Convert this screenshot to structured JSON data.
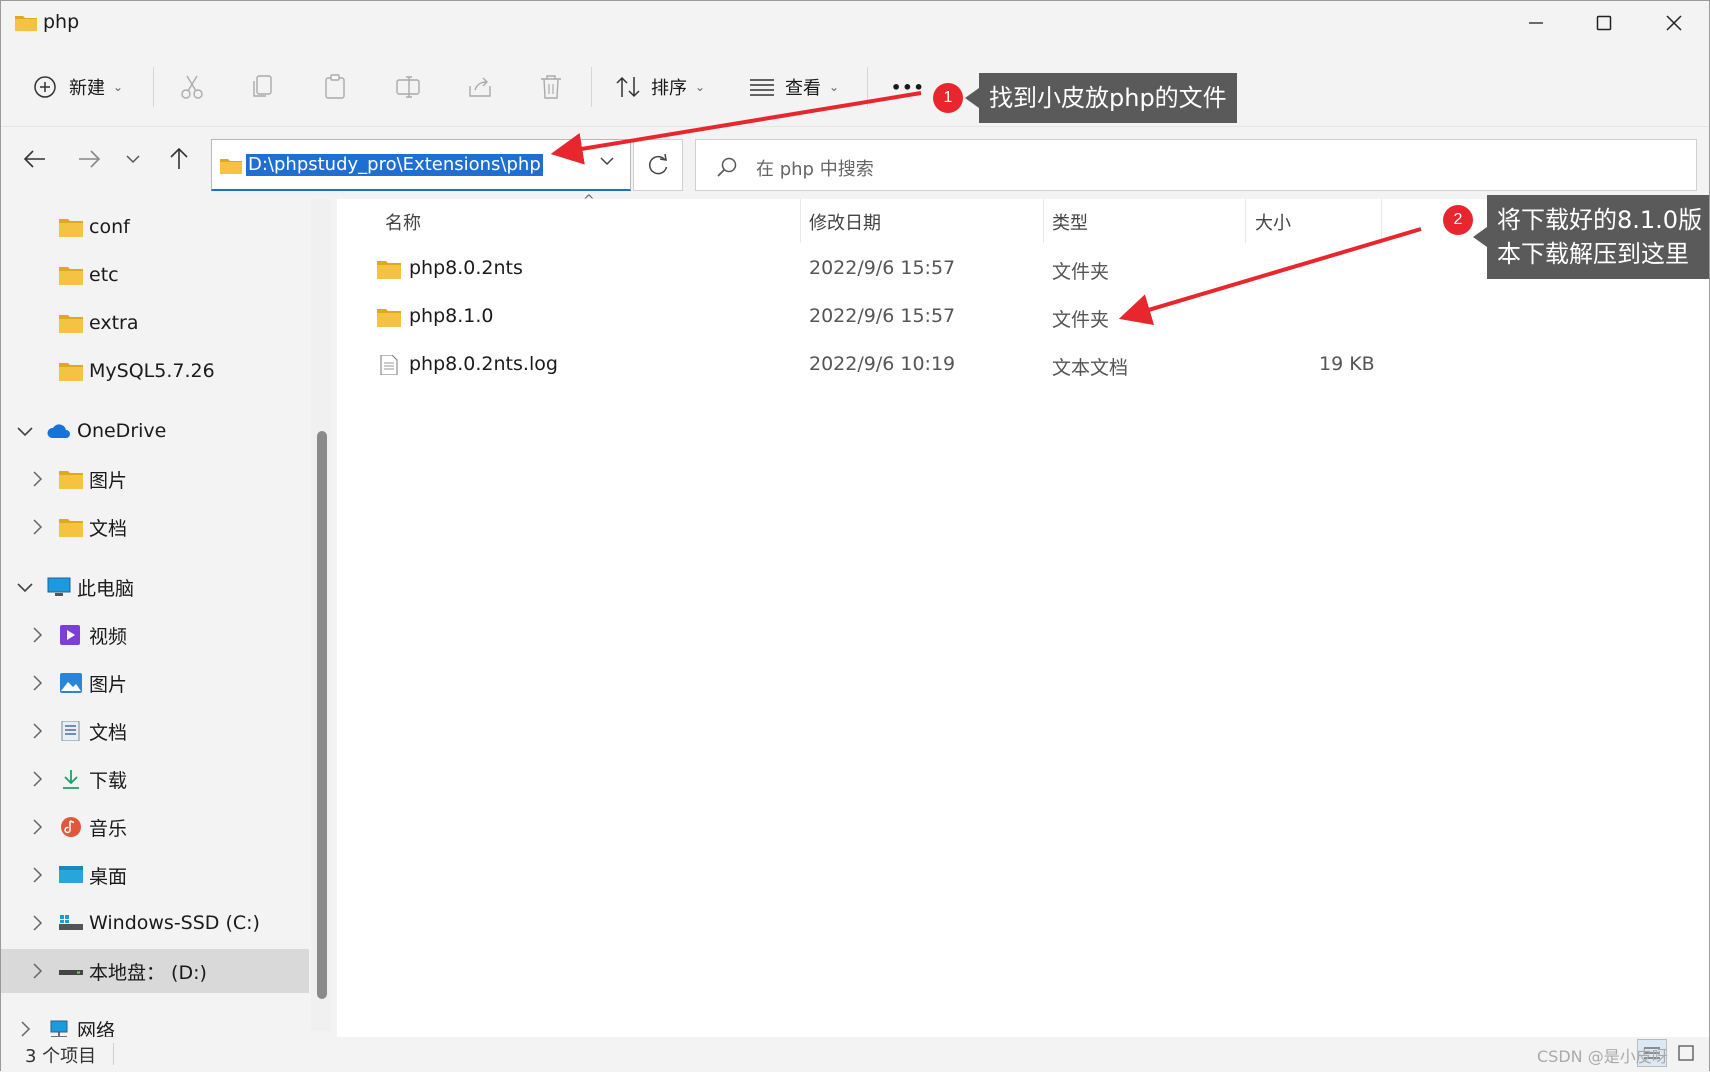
{
  "window": {
    "title": "php",
    "controls": {
      "minimize": "—",
      "maximize": "☐",
      "close": "✕"
    }
  },
  "toolbar": {
    "new_label": "新建",
    "sort_label": "排序",
    "view_label": "查看",
    "more_label": "•••"
  },
  "nav": {
    "address": "D:\\phpstudy_pro\\Extensions\\php",
    "search_placeholder": "在 php 中搜索"
  },
  "sidebar": {
    "items": [
      {
        "label": "conf",
        "icon": "folder-icon"
      },
      {
        "label": "etc",
        "icon": "folder-icon"
      },
      {
        "label": "extra",
        "icon": "folder-icon"
      },
      {
        "label": "MySQL5.7.26",
        "icon": "folder-icon"
      },
      {
        "label": "OneDrive",
        "icon": "cloud-icon"
      },
      {
        "label": "图片",
        "icon": "folder-icon"
      },
      {
        "label": "文档",
        "icon": "folder-icon"
      },
      {
        "label": "此电脑",
        "icon": "computer-icon"
      },
      {
        "label": "视频",
        "icon": "video-icon"
      },
      {
        "label": "图片",
        "icon": "pictures-icon"
      },
      {
        "label": "文档",
        "icon": "documents-icon"
      },
      {
        "label": "下载",
        "icon": "download-icon"
      },
      {
        "label": "音乐",
        "icon": "music-icon"
      },
      {
        "label": "桌面",
        "icon": "desktop-icon"
      },
      {
        "label": "Windows-SSD (C:)",
        "icon": "drive-icon"
      },
      {
        "label": "本地盘： (D:)",
        "icon": "drive-icon"
      },
      {
        "label": "网络",
        "icon": "network-icon"
      }
    ]
  },
  "columns": {
    "name": "名称",
    "modified": "修改日期",
    "type": "类型",
    "size": "大小"
  },
  "files": [
    {
      "name": "php8.0.2nts",
      "modified": "2022/9/6 15:57",
      "type": "文件夹",
      "size": "",
      "icon": "folder-icon"
    },
    {
      "name": "php8.1.0",
      "modified": "2022/9/6 15:57",
      "type": "文件夹",
      "size": "",
      "icon": "folder-icon"
    },
    {
      "name": "php8.0.2nts.log",
      "modified": "2022/9/6 10:19",
      "type": "文本文档",
      "size": "19 KB",
      "icon": "text-file-icon"
    }
  ],
  "status": {
    "count": "3 个项目"
  },
  "annotations": {
    "badge1": "1",
    "callout1": "找到小皮放php的文件",
    "badge2": "2",
    "callout2_line1": "将下载好的8.1.0版",
    "callout2_line2": "本下载解压到这里"
  },
  "watermark": "CSDN @是小皮呀",
  "colors": {
    "accent": "#1e6fd1",
    "folder": "#f5c242",
    "annotation_red": "#e8262d",
    "callout_bg": "#5a5a5a"
  }
}
